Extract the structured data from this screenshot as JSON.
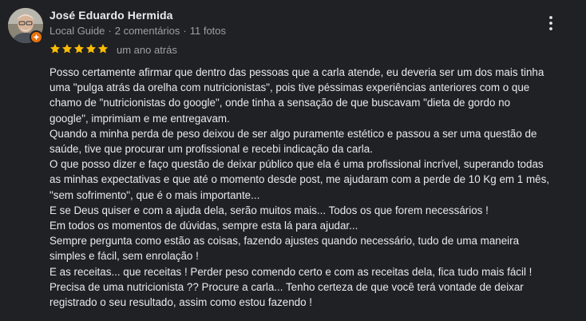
{
  "review": {
    "author_name": "José Eduardo Hermida",
    "author_meta": {
      "badge": "Local Guide",
      "comments": "2 comentários",
      "photos": "11 fotos"
    },
    "rating": 5,
    "rating_max": 5,
    "star_color": "#fbbc04",
    "badge_color": "#e8710a",
    "time": "um ano atrás",
    "more_icon": "more-vert-icon",
    "text_lines": [
      "Posso certamente afirmar que dentro das pessoas que a carla atende, eu deveria ser um dos mais tinha",
      "uma \"pulga atrás da orelha com nutricionistas\", pois tive péssimas experiências anteriores com o que",
      "chamo de \"nutricionistas do google\", onde tinha a sensação de que buscavam \"dieta de gordo no",
      "google\", imprimiam e me entregavam.",
      "Quando a minha perda de peso deixou de ser algo puramente estético e passou a ser uma questão de",
      "saúde, tive que procurar um profissional e recebi indicação da carla.",
      "O que posso dizer e faço questão de deixar público que ela é uma profissional incrível, superando todas",
      "as minhas expectativas e que até o momento desde post, me ajudaram com a perde de 10 Kg em 1 mês,",
      "\"sem sofrimento\", que é o mais importante...",
      "E se Deus quiser e com a ajuda dela, serão  muitos mais... Todos os que forem necessários !",
      "Em todos os momentos de dúvidas, sempre esta lá para ajudar...",
      "Sempre pergunta como estão as coisas, fazendo ajustes quando necessário, tudo de uma maneira",
      "simples e fácil, sem enrolação !",
      "E as receitas... que receitas ! Perder peso comendo certo e com as receitas dela, fica tudo mais fácil !",
      "Precisa de uma nutricionista ?? Procure a carla... Tenho certeza de que você terá vontade de deixar",
      "registrado o seu resultado, assim como estou fazendo !"
    ]
  }
}
